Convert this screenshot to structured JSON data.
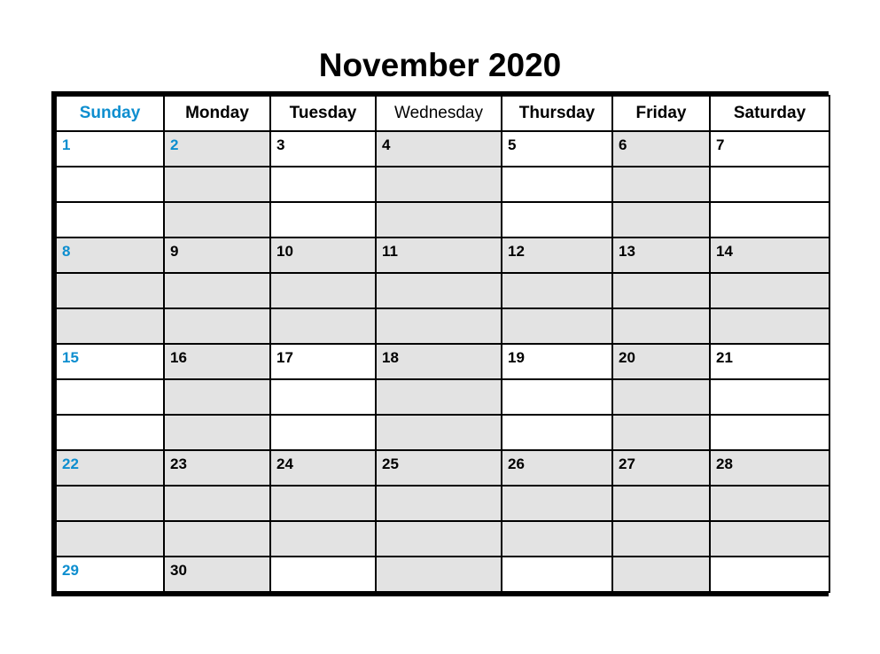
{
  "title": "November 2020",
  "colors": {
    "sunday_accent": "#0d8ecf",
    "shaded_cell": "#e3e3e3",
    "plain_cell": "#ffffff",
    "border": "#000000",
    "text": "#000000"
  },
  "weekday_headers": [
    {
      "label": "Sunday",
      "accent": true,
      "narrow": false
    },
    {
      "label": "Monday",
      "accent": false,
      "narrow": false
    },
    {
      "label": "Tuesday",
      "accent": false,
      "narrow": false
    },
    {
      "label": "Wednesday",
      "accent": false,
      "narrow": true
    },
    {
      "label": "Thursday",
      "accent": false,
      "narrow": false
    },
    {
      "label": "Friday",
      "accent": false,
      "narrow": false
    },
    {
      "label": "Saturday",
      "accent": false,
      "narrow": false
    }
  ],
  "weeks": [
    {
      "dates": [
        "1",
        "2",
        "3",
        "4",
        "5",
        "6",
        "7"
      ],
      "accent": [
        true,
        true,
        false,
        false,
        false,
        false,
        false
      ],
      "shaded": [
        false,
        true,
        false,
        true,
        false,
        true,
        false
      ],
      "subrows": 3
    },
    {
      "dates": [
        "8",
        "9",
        "10",
        "11",
        "12",
        "13",
        "14"
      ],
      "accent": [
        true,
        false,
        false,
        false,
        false,
        false,
        false
      ],
      "shaded": [
        true,
        true,
        true,
        true,
        true,
        true,
        true
      ],
      "subrows": 3
    },
    {
      "dates": [
        "15",
        "16",
        "17",
        "18",
        "19",
        "20",
        "21"
      ],
      "accent": [
        true,
        false,
        false,
        false,
        false,
        false,
        false
      ],
      "shaded": [
        false,
        true,
        false,
        true,
        false,
        true,
        false
      ],
      "subrows": 3
    },
    {
      "dates": [
        "22",
        "23",
        "24",
        "25",
        "26",
        "27",
        "28"
      ],
      "accent": [
        true,
        false,
        false,
        false,
        false,
        false,
        false
      ],
      "shaded": [
        true,
        true,
        true,
        true,
        true,
        true,
        true
      ],
      "subrows": 3
    },
    {
      "dates": [
        "29",
        "30",
        "",
        "",
        "",
        "",
        ""
      ],
      "accent": [
        true,
        false,
        false,
        false,
        false,
        false,
        false
      ],
      "shaded": [
        false,
        true,
        false,
        true,
        false,
        true,
        false
      ],
      "subrows": 1
    }
  ]
}
